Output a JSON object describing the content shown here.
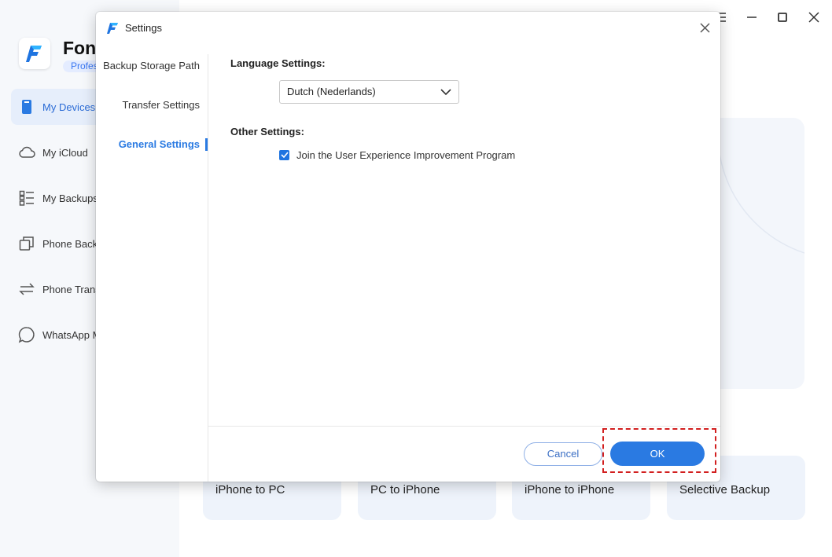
{
  "app": {
    "name": "Fone",
    "edition": "Profes"
  },
  "sidebar": {
    "items": [
      {
        "label": "My Devices",
        "icon": "phone-icon",
        "active": true
      },
      {
        "label": "My iCloud",
        "icon": "cloud-icon",
        "active": false
      },
      {
        "label": "My Backups",
        "icon": "list-icon",
        "active": false
      },
      {
        "label": "Phone Backu",
        "icon": "copy-icon",
        "active": false
      },
      {
        "label": "Phone Trans",
        "icon": "transfer-arrows-icon",
        "active": false
      },
      {
        "label": "WhatsApp M",
        "icon": "chat-bubble-icon",
        "active": false
      }
    ]
  },
  "window_controls": [
    "menu-icon",
    "minimize-icon",
    "maximize-icon",
    "close-icon"
  ],
  "feature_cards": [
    {
      "label": "iPhone to PC"
    },
    {
      "label": "PC to iPhone"
    },
    {
      "label": "iPhone to iPhone"
    },
    {
      "label": "Selective Backup"
    }
  ],
  "dialog": {
    "title": "Settings",
    "nav": [
      {
        "label": "Backup Storage Path",
        "active": false
      },
      {
        "label": "Transfer Settings",
        "active": false
      },
      {
        "label": "General Settings",
        "active": true
      }
    ],
    "language_section_label": "Language Settings:",
    "language_value": "Dutch (Nederlands)",
    "other_section_label": "Other Settings:",
    "ux_program_label": "Join the User Experience Improvement Program",
    "ux_program_checked": true,
    "cancel_label": "Cancel",
    "ok_label": "OK"
  },
  "colors": {
    "accent": "#2a7ae2",
    "highlight": "#d21f1f",
    "sidebar_active_bg": "#e6eefb"
  }
}
